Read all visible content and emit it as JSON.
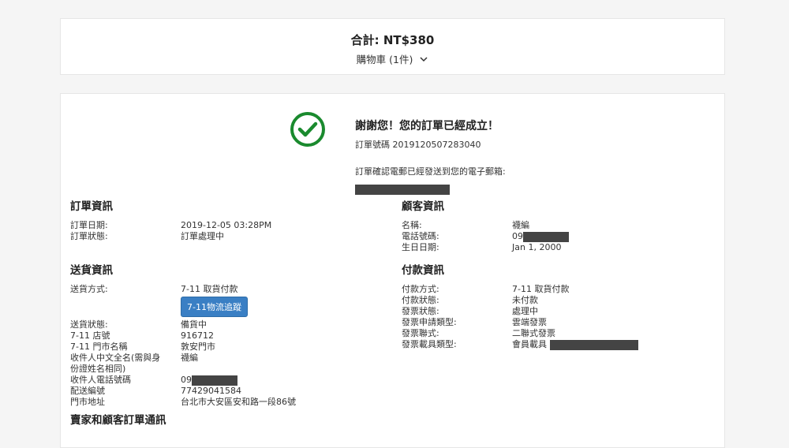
{
  "summary": {
    "total": "合計: NT$380",
    "cart_label": "購物車 (1件)"
  },
  "confirmation": {
    "title": "謝謝您！您的訂單已經成立！",
    "order_number": "訂單號碼 2019120507283040",
    "email_note": "訂單確認電郵已經發送到您的電子郵箱:"
  },
  "order_info": {
    "heading": "訂單資訊",
    "rows": [
      {
        "label": "訂單日期:",
        "value": "2019-12-05 03:28PM"
      },
      {
        "label": "訂單狀態:",
        "value": "訂單處理中"
      }
    ]
  },
  "customer_info": {
    "heading": "顧客資訊",
    "name_label": "名稱:",
    "name_value": "襪編",
    "phone_label": "電話號碼:",
    "phone_value": "09",
    "birthday_label": "生日日期:",
    "birthday_value": "Jan 1, 2000"
  },
  "shipping_info": {
    "heading": "送貨資訊",
    "method_label": "送貨方式:",
    "method_value": "7-11 取貨付款",
    "track_button": "7-11物流追蹤",
    "status_label": "送貨狀態:",
    "status_value": "備貨中",
    "store_no_label": "7-11 店號",
    "store_no_value": "916712",
    "store_name_label": "7-11 門市名稱",
    "store_name_value": "敦安門市",
    "recipient_label": "收件人中文全名(需與身份證姓名相同)",
    "recipient_value": "襪編",
    "recipient_phone_label": "收件人電話號碼",
    "recipient_phone_value": "09",
    "delivery_no_label": "配送編號",
    "delivery_no_value": "77429041584",
    "address_label": "門市地址",
    "address_value": "台北市大安區安和路一段86號"
  },
  "payment_info": {
    "heading": "付款資訊",
    "rows": [
      {
        "label": "付款方式:",
        "value": "7-11 取貨付款"
      },
      {
        "label": "付款狀態:",
        "value": "未付款"
      },
      {
        "label": "發票狀態:",
        "value": "處理中"
      },
      {
        "label": "發票申請類型:",
        "value": "雲端發票"
      },
      {
        "label": "發票聯式:",
        "value": "二聯式發票"
      }
    ],
    "carrier_label": "發票載具類型:",
    "carrier_value": "會員載具"
  },
  "communication": {
    "heading": "賣家和顧客訂單通訊"
  },
  "colors": {
    "success": "#1a8a2e",
    "button": "#3a7fc4"
  }
}
